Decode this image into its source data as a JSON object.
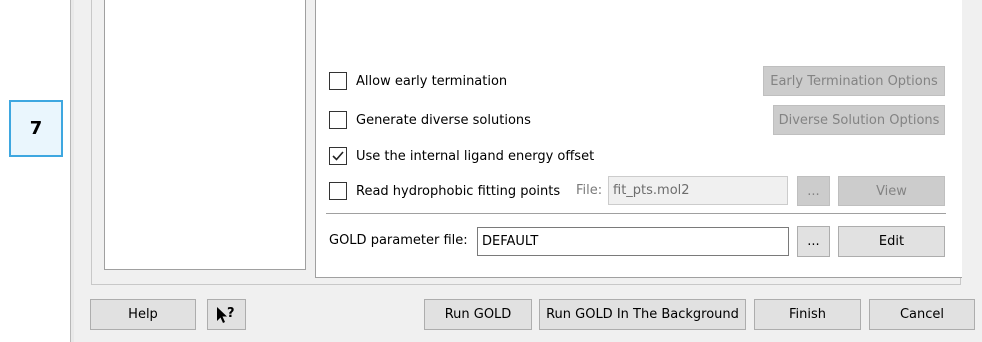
{
  "step_badge": "7",
  "options": {
    "early_termination": {
      "label": "Allow early termination",
      "checked": false,
      "button": "Early Termination Options"
    },
    "diverse_solutions": {
      "label": "Generate diverse solutions",
      "checked": false,
      "button": "Diverse Solution Options"
    },
    "ligand_energy": {
      "label": "Use the internal ligand energy offset",
      "checked": true
    },
    "hydrophobic": {
      "label": "Read hydrophobic fitting points",
      "checked": false,
      "file_label": "File:",
      "file_value": "fit_pts.mol2",
      "browse": "...",
      "view": "View"
    }
  },
  "param_file": {
    "label": "GOLD parameter file:",
    "value": "DEFAULT",
    "browse": "...",
    "edit": "Edit"
  },
  "footer": {
    "help": "Help",
    "run_gold": "Run GOLD",
    "run_background": "Run GOLD In The Background",
    "finish": "Finish",
    "cancel": "Cancel"
  },
  "icons": {
    "context_help": "context-help-icon",
    "checkmark": "checkmark-icon"
  }
}
